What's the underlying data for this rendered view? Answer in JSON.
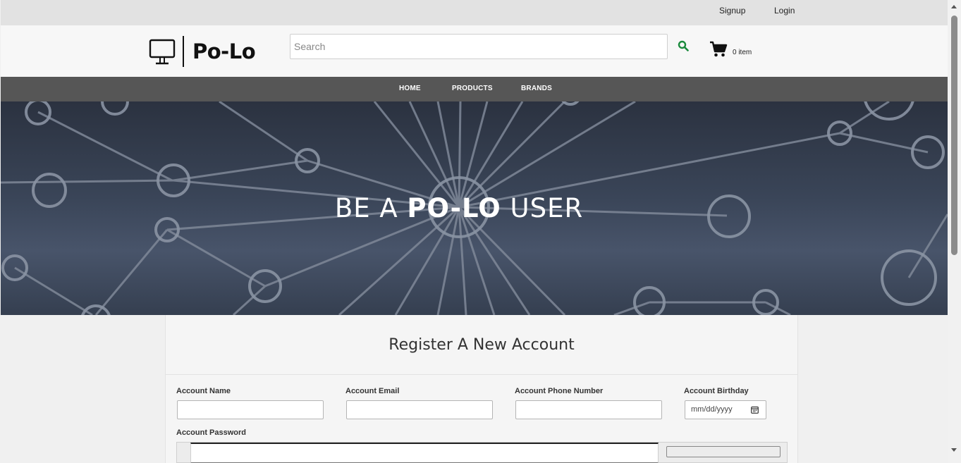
{
  "topbar": {
    "signup": "Signup",
    "login": "Login"
  },
  "header": {
    "brand": "Po-Lo",
    "search_placeholder": "Search",
    "cart_count": "0 item"
  },
  "nav": {
    "items": [
      "HOME",
      "PRODUCTS",
      "BRANDS"
    ]
  },
  "hero": {
    "prefix": "BE A ",
    "emphasis": "PO-LO",
    "suffix": " USER"
  },
  "form": {
    "title": "Register A New Account",
    "name_label": "Account Name",
    "email_label": "Account Email",
    "phone_label": "Account Phone Number",
    "birthday_label": "Account Birthday",
    "birthday_placeholder": "mm/dd/yyyy",
    "password_label": "Account Password"
  },
  "colors": {
    "nav_bg": "#565656",
    "search_icon": "#1a8a3c",
    "hero_bg": "#3a4558"
  }
}
